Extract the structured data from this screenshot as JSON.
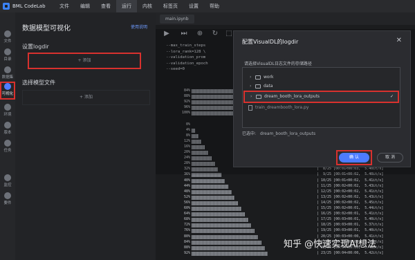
{
  "app": {
    "name": "BML CodeLab"
  },
  "menu": [
    "文件",
    "编辑",
    "查看",
    "运行",
    "内核",
    "标签页",
    "设置",
    "帮助"
  ],
  "activity": [
    {
      "label": "文件",
      "icon": "folder-icon"
    },
    {
      "label": "目录",
      "icon": "list-icon"
    },
    {
      "label": "数据集",
      "icon": "dataset-icon"
    },
    {
      "label": "可视化",
      "icon": "visualization-icon"
    },
    {
      "label": "环境",
      "icon": "environment-icon"
    },
    {
      "label": "版本",
      "icon": "version-icon"
    },
    {
      "label": "任务",
      "icon": "task-icon"
    },
    {
      "label": "监控",
      "icon": "monitor-icon"
    },
    {
      "label": "要件",
      "icon": "plugin-icon"
    }
  ],
  "panel": {
    "title": "数据模型可视化",
    "help_link": "使用说明",
    "logdir_section": "设置logdir",
    "add_label": "+ 添加",
    "model_section": "选择模型文件",
    "add_model_label": "+ 添加"
  },
  "editor": {
    "tab": "main.ipynb",
    "code": [
      {
        "no": "",
        "text": "--max_train_steps"
      },
      {
        "no": "",
        "text": "--lora_rank=128 \\"
      },
      {
        "no": "",
        "text": "--validation_prom"
      },
      {
        "no": "",
        "text": "--validation_epoch"
      },
      {
        "no": "",
        "text": "--seed=0"
      }
    ],
    "progress": [
      {
        "pct": "84%",
        "frac": 0.84,
        "stat": ""
      },
      {
        "pct": "88%",
        "frac": 0.88,
        "stat": ""
      },
      {
        "pct": "92%",
        "frac": 0.92,
        "stat": ""
      },
      {
        "pct": "96%",
        "frac": 0.96,
        "stat": ""
      },
      {
        "pct": "100%",
        "frac": 1.0,
        "stat": ""
      },
      {
        "pct": "0%",
        "frac": 0.0,
        "stat": ""
      },
      {
        "pct": "4%",
        "frac": 0.04,
        "stat": ""
      },
      {
        "pct": "8%",
        "frac": 0.08,
        "stat": ""
      },
      {
        "pct": "12%",
        "frac": 0.12,
        "stat": ""
      },
      {
        "pct": "16%",
        "frac": 0.16,
        "stat": ""
      },
      {
        "pct": "20%",
        "frac": 0.2,
        "stat": ""
      },
      {
        "pct": "24%",
        "frac": 0.24,
        "stat": ""
      },
      {
        "pct": "28%",
        "frac": 0.28,
        "stat": ""
      },
      {
        "pct": "32%",
        "frac": 0.32,
        "stat": "|  8/25 [00:01<00:03,  5.40it/s]"
      },
      {
        "pct": "36%",
        "frac": 0.36,
        "stat": "|  9/25 [00:01<00:02,  5.40it/s]"
      },
      {
        "pct": "40%",
        "frac": 0.4,
        "stat": "| 10/25 [00:01<00:02,  5.41it/s]"
      },
      {
        "pct": "44%",
        "frac": 0.44,
        "stat": "| 11/25 [00:02<00:02,  5.43it/s]"
      },
      {
        "pct": "48%",
        "frac": 0.48,
        "stat": "| 12/25 [00:02<00:02,  5.41it/s]"
      },
      {
        "pct": "52%",
        "frac": 0.52,
        "stat": "| 13/25 [00:02<00:02,  5.43it/s]"
      },
      {
        "pct": "56%",
        "frac": 0.56,
        "stat": "| 14/25 [00:02<00:02,  5.45it/s]"
      },
      {
        "pct": "60%",
        "frac": 0.6,
        "stat": "| 15/25 [00:02<00:01,  5.44it/s]"
      },
      {
        "pct": "64%",
        "frac": 0.64,
        "stat": "| 16/25 [00:02<00:01,  5.41it/s]"
      },
      {
        "pct": "68%",
        "frac": 0.68,
        "stat": "| 17/25 [00:03<00:01,  5.40it/s]"
      },
      {
        "pct": "72%",
        "frac": 0.72,
        "stat": "| 18/25 [00:03<00:01,  5.37it/s]"
      },
      {
        "pct": "76%",
        "frac": 0.76,
        "stat": "| 19/25 [00:03<00:01,  5.40it/s]"
      },
      {
        "pct": "80%",
        "frac": 0.8,
        "stat": "| 20/25 [00:03<00:00,  5.41it/s]"
      },
      {
        "pct": "84%",
        "frac": 0.84,
        "stat": "| 21/25 [00:03<00:00,  5.41it/s]"
      },
      {
        "pct": "88%",
        "frac": 0.88,
        "stat": "| 22/25 [00:04<00:00,  5.43it/s]"
      },
      {
        "pct": "92%",
        "frac": 0.92,
        "stat": "| 23/25 [00:04<00:00,  5.42it/s]"
      }
    ]
  },
  "dialog": {
    "title": "配置VisualDL的logdir",
    "subtitle": "请选择VisualDL日志文件的存储路径",
    "tree": [
      {
        "label": "work",
        "type": "folder",
        "selected": false
      },
      {
        "label": "data",
        "type": "folder",
        "selected": false
      },
      {
        "label": "dream_booth_lora_outputs",
        "type": "folder",
        "selected": true
      },
      {
        "label": "train_dreambooth_lora.py",
        "type": "file",
        "selected": false
      }
    ],
    "chosen_label": "已选中:",
    "chosen_value": "dream_booth_lora_outputs",
    "confirm": "确 认",
    "cancel": "取 消"
  },
  "watermark": "知乎 @快速实现AI想法"
}
